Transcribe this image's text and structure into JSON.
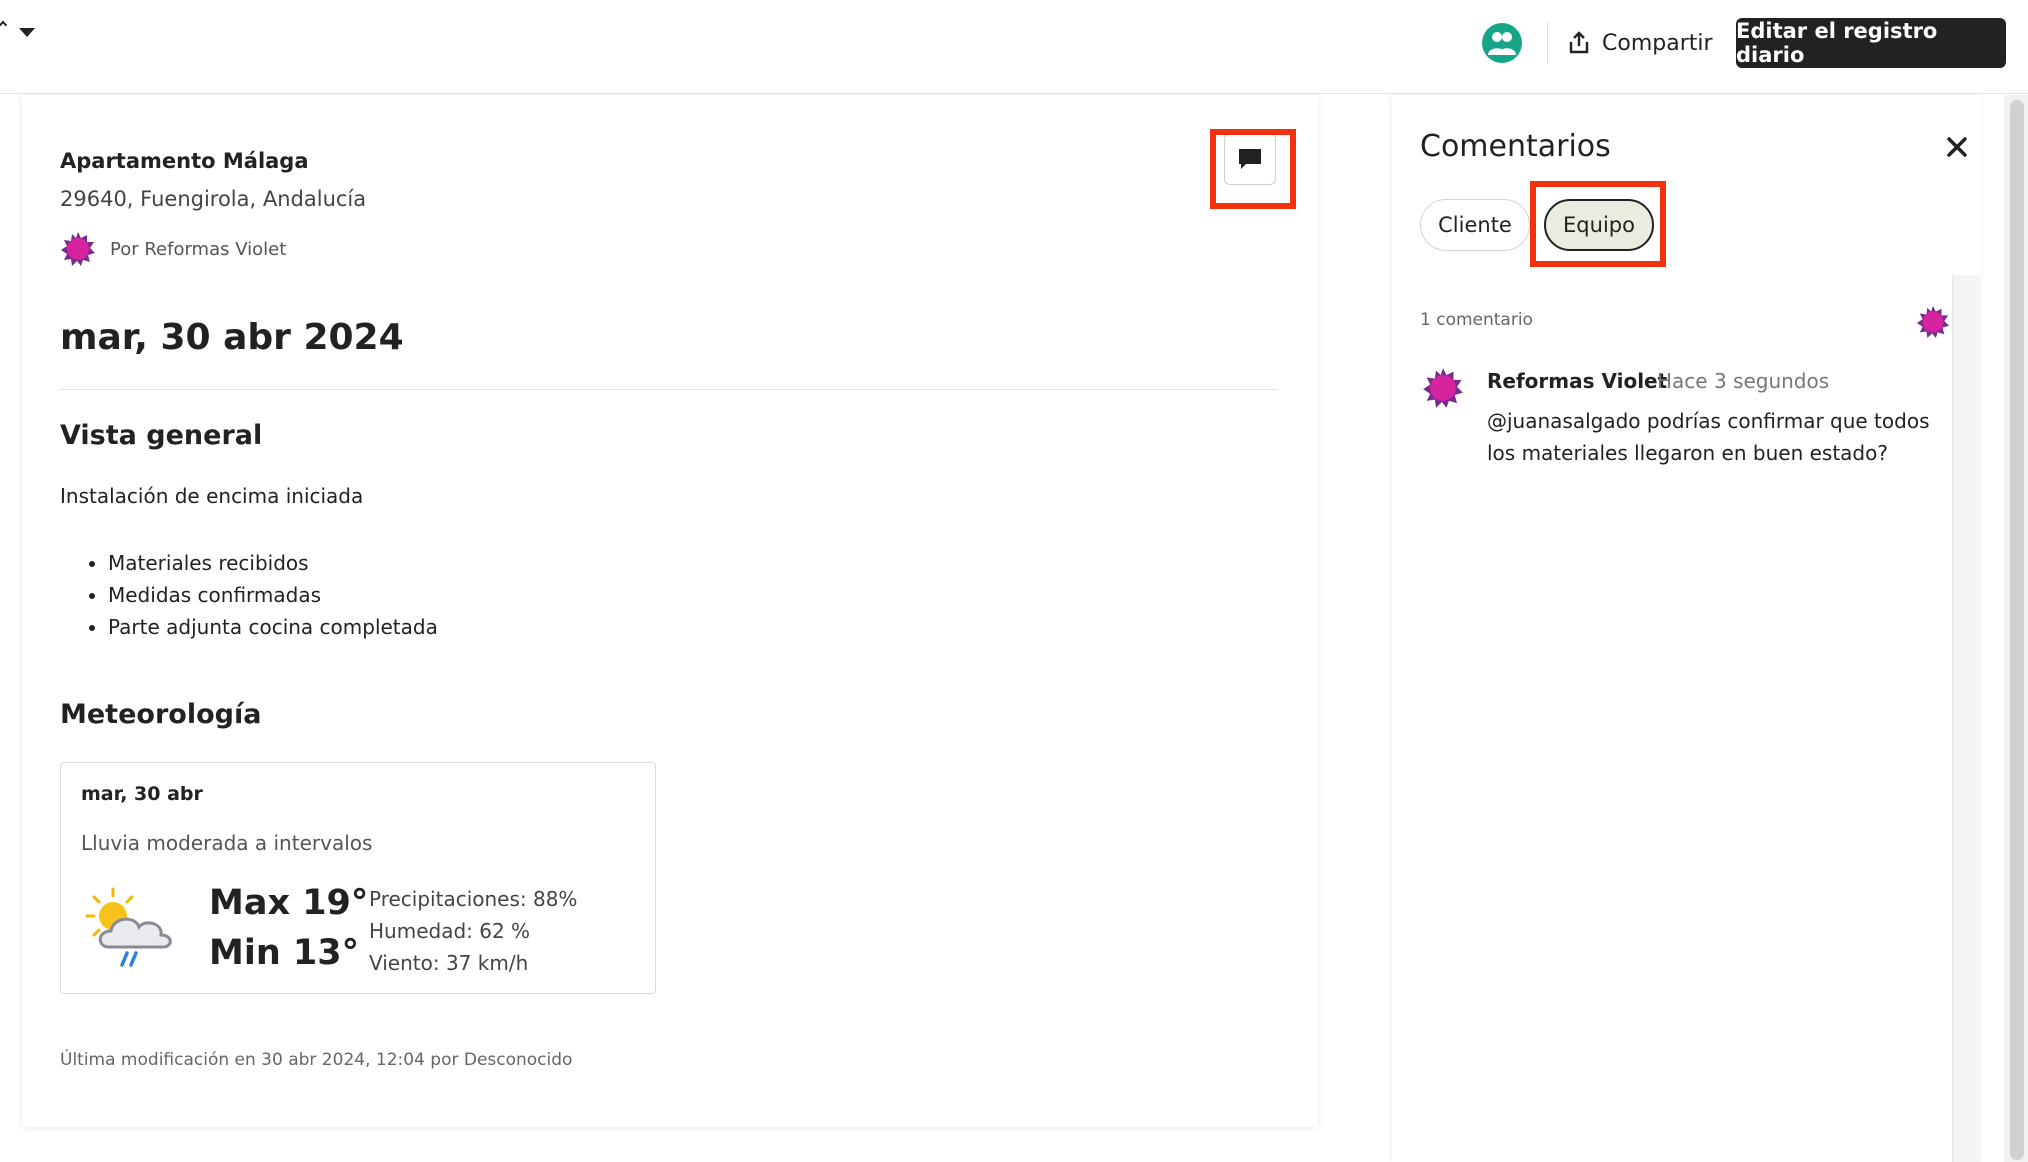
{
  "header": {
    "share_label": "Compartir",
    "edit_label": "Editar el registro diario"
  },
  "log": {
    "project_name": "Apartamento Málaga",
    "address": "29640, Fuengirola, Andalucía",
    "author": "Por Reformas Violet",
    "date": "mar, 30 abr 2024",
    "overview_title": "Vista general",
    "overview_text": "Instalación de encima iniciada",
    "bullets": [
      "Materiales recibidos",
      "Medidas confirmadas",
      "Parte adjunta cocina completada"
    ],
    "weather_title": "Meteorología",
    "weather": {
      "date": "mar, 30 abr",
      "condition": "Lluvia moderada a intervalos",
      "max": "Max 19°",
      "min": "Min 13°",
      "precipitation": "Precipitaciones: 88%",
      "humidity": "Humedad: 62 %",
      "wind": "Viento: 37 km/h",
      "icon": "sun-cloud-rain-icon"
    },
    "last_modified": "Última modificación en 30 abr 2024, 12:04 por Desconocido"
  },
  "comments": {
    "title": "Comentarios",
    "tabs": [
      {
        "label": "Cliente",
        "selected": false
      },
      {
        "label": "Equipo",
        "selected": true
      }
    ],
    "count": "1 comentario",
    "items": [
      {
        "author": "Reformas Violet",
        "time": "Hace 3 segundos",
        "text": "@juanasalgado podrías confirmar que todos los materiales llegaron en buen estado?"
      }
    ]
  },
  "colors": {
    "highlight": "#f2310f",
    "primary_button": "#222222",
    "team_avatar": "#17a589",
    "brand_avatar": "#d6249f",
    "selected_tab": "#ebebdf"
  }
}
